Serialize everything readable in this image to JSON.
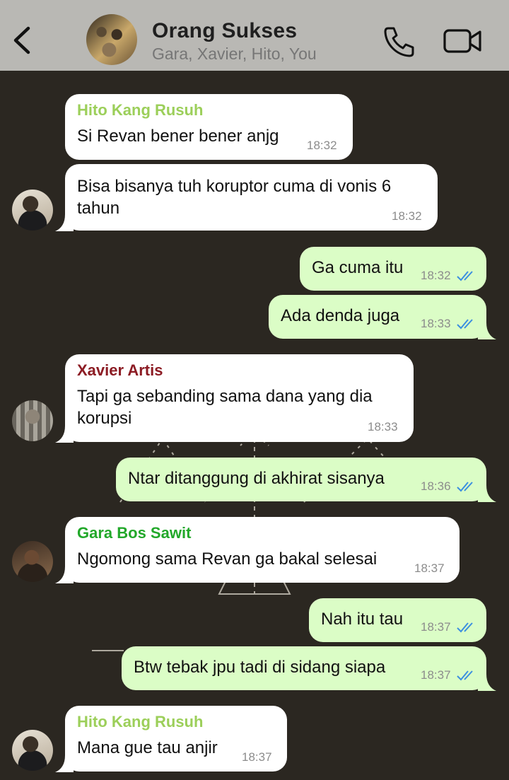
{
  "header": {
    "title": "Orang Sukses",
    "subtitle": "Gara, Xavier, Hito, You"
  },
  "colors": {
    "header_bg": "#b9b8b4",
    "chat_bg": "#2b2721",
    "incoming_bubble": "#ffffff",
    "outgoing_bubble": "#dbfdc6",
    "read_ticks": "#3b8fe0",
    "sender_hito": "#9ccf5a",
    "sender_xavier": "#8c1c24",
    "sender_gara": "#22a82a"
  },
  "icons": {
    "back": "chevron-left-icon",
    "call": "phone-icon",
    "video": "video-camera-icon",
    "read": "double-check-icon"
  },
  "messages": [
    {
      "sender": "Hito Kang Rusuh",
      "text": "Si Revan bener bener anjg",
      "time": "18:32"
    },
    {
      "line1": "Bisa bisanya tuh koruptor cuma di vonis 6",
      "line2": "tahun",
      "time": "18:32"
    },
    {
      "text": "Ga cuma itu",
      "time": "18:32"
    },
    {
      "text": "Ada denda juga",
      "time": "18:33"
    },
    {
      "sender": "Xavier Artis",
      "line1": "Tapi ga sebanding sama dana yang dia",
      "line2": "korupsi",
      "time": "18:33"
    },
    {
      "text": "Ntar ditanggung di akhirat sisanya",
      "time": "18:36"
    },
    {
      "sender": "Gara Bos Sawit",
      "text": "Ngomong sama Revan ga bakal selesai",
      "time": "18:37"
    },
    {
      "text": "Nah itu tau",
      "time": "18:37"
    },
    {
      "text": "Btw tebak jpu tadi di sidang siapa",
      "time": "18:37"
    },
    {
      "sender": "Hito Kang Rusuh",
      "text": "Mana gue tau anjir",
      "time": "18:37"
    }
  ]
}
